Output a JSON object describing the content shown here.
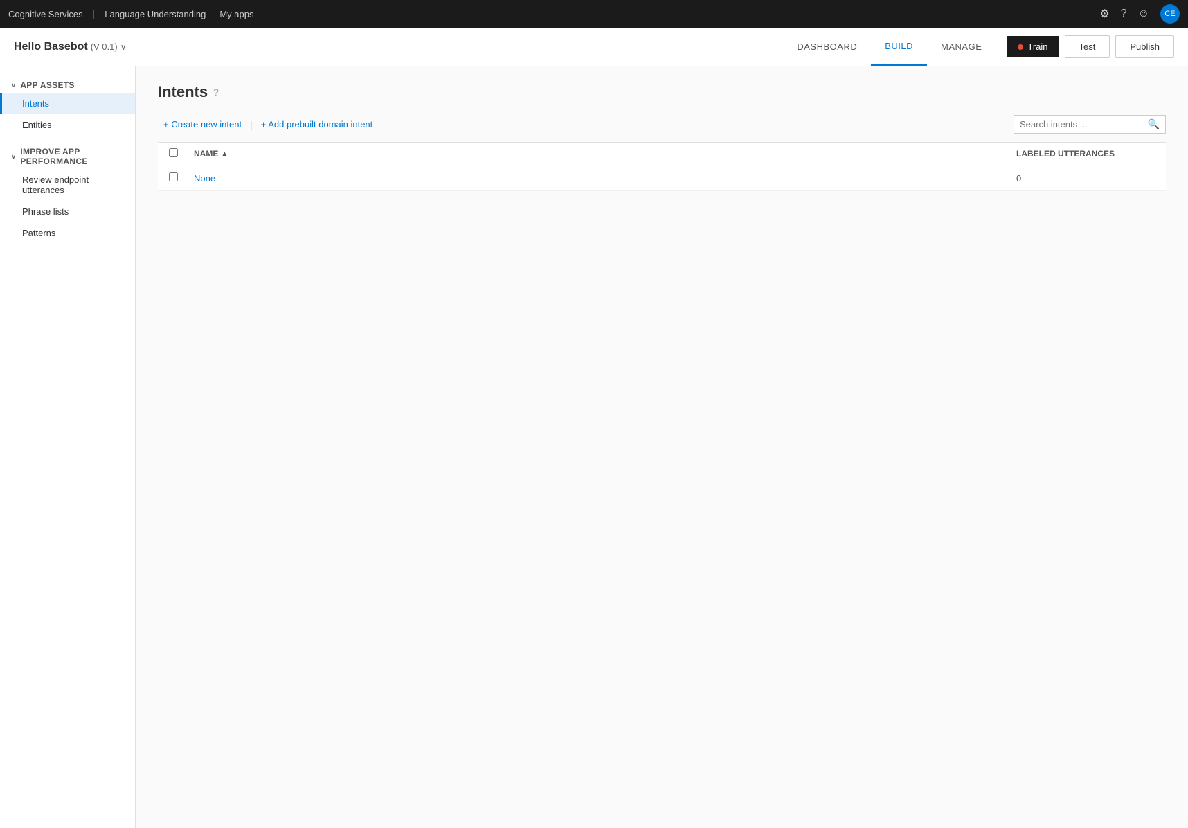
{
  "topbar": {
    "brand": "Cognitive Services",
    "divider": "|",
    "app": "Language Understanding",
    "myapps": "My apps",
    "icons": {
      "settings": "⚙",
      "help": "?",
      "smiley": "☺"
    },
    "avatar": "CE"
  },
  "header": {
    "app_name": "Hello Basebot",
    "version": "(V 0.1)",
    "chevron": "∨",
    "nav": [
      {
        "label": "DASHBOARD",
        "active": false
      },
      {
        "label": "BUILD",
        "active": true
      },
      {
        "label": "MANAGE",
        "active": false
      }
    ],
    "train_label": "Train",
    "test_label": "Test",
    "publish_label": "Publish"
  },
  "sidebar": {
    "sections": [
      {
        "label": "App Assets",
        "expanded": true,
        "items": [
          {
            "label": "Intents",
            "active": true
          },
          {
            "label": "Entities",
            "active": false
          }
        ]
      },
      {
        "label": "Improve app performance",
        "expanded": true,
        "items": [
          {
            "label": "Review endpoint utterances",
            "active": false
          },
          {
            "label": "Phrase lists",
            "active": false
          },
          {
            "label": "Patterns",
            "active": false
          }
        ]
      }
    ]
  },
  "main": {
    "page_title": "Intents",
    "page_title_icon": "?",
    "toolbar": {
      "create_intent": "+ Create new intent",
      "add_prebuilt": "+ Add prebuilt domain intent"
    },
    "search": {
      "placeholder": "Search intents ..."
    },
    "table": {
      "columns": [
        {
          "label": "Name",
          "sortable": true,
          "sort_icon": "▲"
        },
        {
          "label": "Labeled Utterances",
          "sortable": false
        }
      ],
      "rows": [
        {
          "name": "None",
          "labeled_utterances": "0"
        }
      ]
    }
  }
}
